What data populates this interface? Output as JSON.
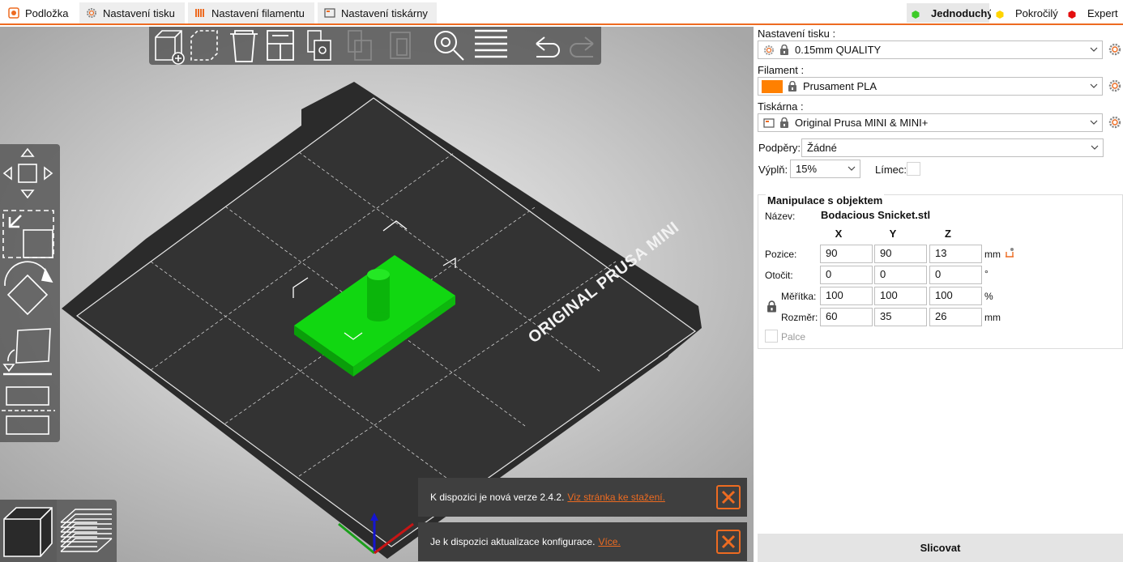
{
  "tabs": [
    {
      "label": "Podložka",
      "icon": "plater-icon",
      "active": true
    },
    {
      "label": "Nastavení tisku",
      "icon": "print-settings-gear-icon",
      "active": false
    },
    {
      "label": "Nastavení filamentu",
      "icon": "filament-spool-icon",
      "active": false
    },
    {
      "label": "Nastavení tiskárny",
      "icon": "printer-settings-icon",
      "active": false
    }
  ],
  "modes": [
    {
      "label": "Jednoduchý",
      "color": "#3ecb28",
      "active": true
    },
    {
      "label": "Pokročilý",
      "color": "#ffd400",
      "active": false
    },
    {
      "label": "Expert",
      "color": "#e40f0f",
      "active": false
    }
  ],
  "sidebar": {
    "print_label": "Nastavení tisku :",
    "print_value": "0.15mm QUALITY",
    "filament_label": "Filament :",
    "filament_value": "Prusament PLA",
    "filament_color": "#ff8000",
    "printer_label": "Tiskárna :",
    "printer_value": "Original Prusa MINI & MINI+",
    "supports_label": "Podpěry:",
    "supports_value": "Žádné",
    "infill_label": "Výplň:",
    "infill_value": "15%",
    "brim_label": "Límec:",
    "brim_checked": false
  },
  "manip": {
    "title": "Manipulace s objektem",
    "name_label": "Název:",
    "name_value": "Bodacious Snicket.stl",
    "axes": [
      "X",
      "Y",
      "Z"
    ],
    "position_label": "Pozice:",
    "position": [
      "90",
      "90",
      "13"
    ],
    "position_unit": "mm",
    "rotation_label": "Otočit:",
    "rotation": [
      "0",
      "0",
      "0"
    ],
    "rotation_unit": "°",
    "scale_label": "Měřítka:",
    "scale": [
      "100",
      "100",
      "100"
    ],
    "scale_unit": "%",
    "size_label": "Rozměr:",
    "size": [
      "60",
      "35",
      "26"
    ],
    "size_unit": "mm",
    "inches_label": "Palce",
    "inches_checked": false
  },
  "slice_button": "Slicovat",
  "bed_label": "ORIGINAL PRUSA MINI",
  "model_color": "#11d711",
  "accent_color": "#ed6b21",
  "notifications": [
    {
      "text": "K dispozici je nová verze 2.4.2.",
      "link": "Viz stránka ke stažení."
    },
    {
      "text": "Je k dispozici aktualizace konfigurace.",
      "link": "Více."
    }
  ]
}
